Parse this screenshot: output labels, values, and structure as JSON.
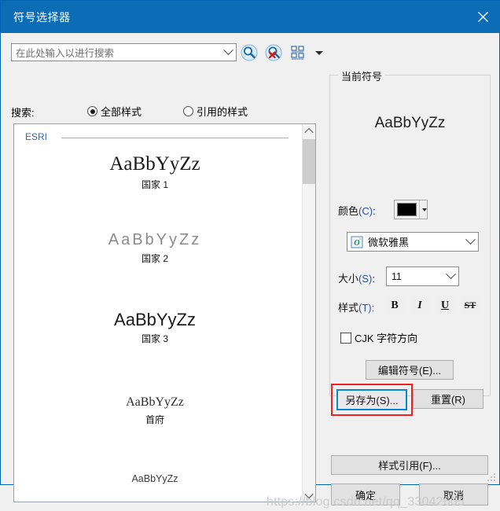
{
  "window": {
    "title": "符号选择器",
    "close_icon": "close-icon",
    "titlebar_color": "#0c6cb5"
  },
  "search": {
    "placeholder": "在此处输入以进行搜索",
    "dropdown_icon": "chevron-down-icon",
    "tools": [
      {
        "name": "search-icon",
        "label": "搜索"
      },
      {
        "name": "clear-search-icon",
        "label": "清除搜索"
      },
      {
        "name": "view-mode-icon",
        "label": "视图"
      },
      {
        "name": "view-mode-dropdown-icon",
        "label": "更多"
      }
    ],
    "scope_label": "搜索:",
    "options": [
      {
        "label": "全部样式",
        "selected": true
      },
      {
        "label": "引用的样式",
        "selected": false
      }
    ]
  },
  "symbol_list": {
    "group_name": "ESRI",
    "items": [
      {
        "sample": "AaBbYyZz",
        "name": "国家 1"
      },
      {
        "sample": "AaBbYyZz",
        "name": "国家 2"
      },
      {
        "sample": "AaBbYyZz",
        "name": "国家 3"
      },
      {
        "sample": "AaBbYyZz",
        "name": "首府"
      },
      {
        "sample": "AaBbYyZz",
        "name": ""
      }
    ],
    "scroll": {
      "up_icon": "chevron-up-icon",
      "down_icon": "chevron-down-icon"
    }
  },
  "current_symbol": {
    "group_title": "当前符号",
    "preview_text": "AaBbYyZz",
    "color_label": "颜色(C):",
    "color_value": "#000000",
    "color_dropdown_icon": "chevron-down-icon",
    "font_icon": "opentype-font-icon",
    "font_value": "微软雅黑",
    "font_dropdown_icon": "chevron-down-icon",
    "size_label": "大小(S):",
    "size_value": "11",
    "size_dropdown_icon": "chevron-down-icon",
    "style_label": "样式(T):",
    "style_buttons": [
      {
        "name": "bold-button",
        "label": "B"
      },
      {
        "name": "italic-button",
        "label": "I"
      },
      {
        "name": "underline-button",
        "label": "U"
      },
      {
        "name": "strikethrough-button",
        "label": "ST"
      }
    ],
    "cjk_label": "CJK 字符方向",
    "cjk_checked": false,
    "edit_symbol_label": "编辑符号(E)...",
    "save_as_label": "另存为(S)...",
    "reset_label": "重置(R)",
    "highlight_color": "#ee2222"
  },
  "footer": {
    "style_ref_label": "样式引用(F)...",
    "ok_label": "确定",
    "cancel_label": "取消"
  },
  "watermark": "https://blog.csdn.net/qq_33042605"
}
